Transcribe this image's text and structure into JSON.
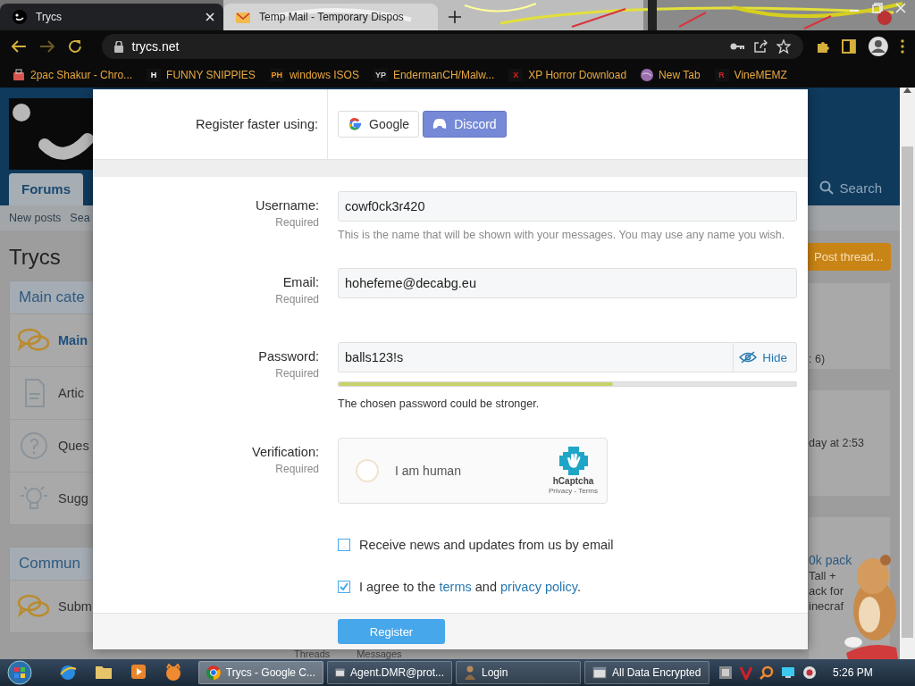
{
  "browser": {
    "tabs": [
      {
        "title": "Trycs",
        "selected": true,
        "kind": "smiley"
      },
      {
        "title": "Temp Mail - Temporary Dispos",
        "selected": false,
        "kind": "envelope"
      }
    ],
    "address": "trycs.net",
    "bookmarks": [
      {
        "label": "2pac Shakur - Chro...",
        "kind": "bag",
        "color": "#d9534f"
      },
      {
        "label": "FUNNY SNIPPIES",
        "kind": "letter",
        "badge": "H",
        "color": "#ffffff"
      },
      {
        "label": "windows ISOS",
        "kind": "letter",
        "badge": "PH",
        "color": "#f7971d"
      },
      {
        "label": "EndermanCH/Malw...",
        "kind": "letter",
        "badge": "YP",
        "color": "#d0d0d0"
      },
      {
        "label": "XP Horror Download",
        "kind": "letter",
        "badge": "X",
        "color": "#e0201b"
      },
      {
        "label": "New Tab",
        "kind": "globe",
        "color": "#9b6fb0"
      },
      {
        "label": "VineMEMZ",
        "kind": "letter",
        "badge": "R",
        "color": "#d0202a"
      }
    ]
  },
  "background_page": {
    "nav_tab": "Forums",
    "search": "Search",
    "subnav": [
      "New posts",
      "Sea"
    ],
    "title": "Trycs",
    "blocks": [
      {
        "heading": "Main cate",
        "items": [
          {
            "label": "Main",
            "unread": true,
            "kind": "chat"
          },
          {
            "label": "Artic",
            "unread": false,
            "kind": "document"
          },
          {
            "label": "Ques",
            "unread": false,
            "kind": "question"
          },
          {
            "label": "Sugg",
            "unread": false,
            "kind": "bulb"
          }
        ]
      },
      {
        "heading": "Commun",
        "items": [
          {
            "label": "Subm",
            "unread": false,
            "kind": "chat"
          }
        ]
      }
    ],
    "post_button": "Post thread...",
    "side_cards": [
      {
        "lines": [
          ": 6)"
        ]
      },
      {
        "lines": [
          "day at 2:53"
        ]
      },
      {
        "lines": [
          "0k pack",
          "Tall +",
          "ack for",
          "inecraf"
        ]
      }
    ],
    "stats": [
      "Threads",
      "Messages"
    ]
  },
  "dialog": {
    "social_label": "Register faster using:",
    "social_buttons": [
      {
        "label": "Google",
        "kind": "google"
      },
      {
        "label": "Discord",
        "kind": "discord"
      }
    ],
    "fields": [
      {
        "kind": "text",
        "label": "Username:",
        "required": "Required",
        "value": "cowf0ck3r420",
        "hint": "This is the name that will be shown with your messages. You may use any name you wish."
      },
      {
        "kind": "text",
        "label": "Email:",
        "required": "Required",
        "value": "hohefeme@decabg.eu"
      },
      {
        "kind": "password",
        "label": "Password:",
        "required": "Required",
        "value": "balls123!s",
        "toggle": "Hide",
        "level": 0.6,
        "message": "The chosen password could be stronger."
      },
      {
        "kind": "captcha",
        "label": "Verification:",
        "required": "Required",
        "checkbox_label": "I am human",
        "checked": false,
        "brand": "hCaptcha",
        "links": "Privacy - Terms"
      },
      {
        "kind": "checkbox",
        "checked": false,
        "segments": [
          {
            "text": "Receive news and updates from us by email",
            "link": false
          }
        ]
      },
      {
        "kind": "checkbox",
        "checked": true,
        "segments": [
          {
            "text": "I agree to the ",
            "link": false
          },
          {
            "text": "terms",
            "link": true
          },
          {
            "text": " and ",
            "link": false
          },
          {
            "text": "privacy policy",
            "link": true
          },
          {
            "text": ".",
            "link": false
          }
        ]
      }
    ],
    "submit": "Register"
  },
  "taskbar": {
    "tasks": [
      {
        "label": "Trycs - Google C...",
        "selected": true,
        "kind": "browser"
      },
      {
        "label": "Agent.DMR@prot...",
        "selected": false,
        "kind": "window"
      },
      {
        "label": "Login",
        "selected": false,
        "kind": "figure"
      },
      {
        "label": "All Data Encrypted",
        "selected": false,
        "kind": "window"
      }
    ],
    "clock": "5:26 PM"
  }
}
